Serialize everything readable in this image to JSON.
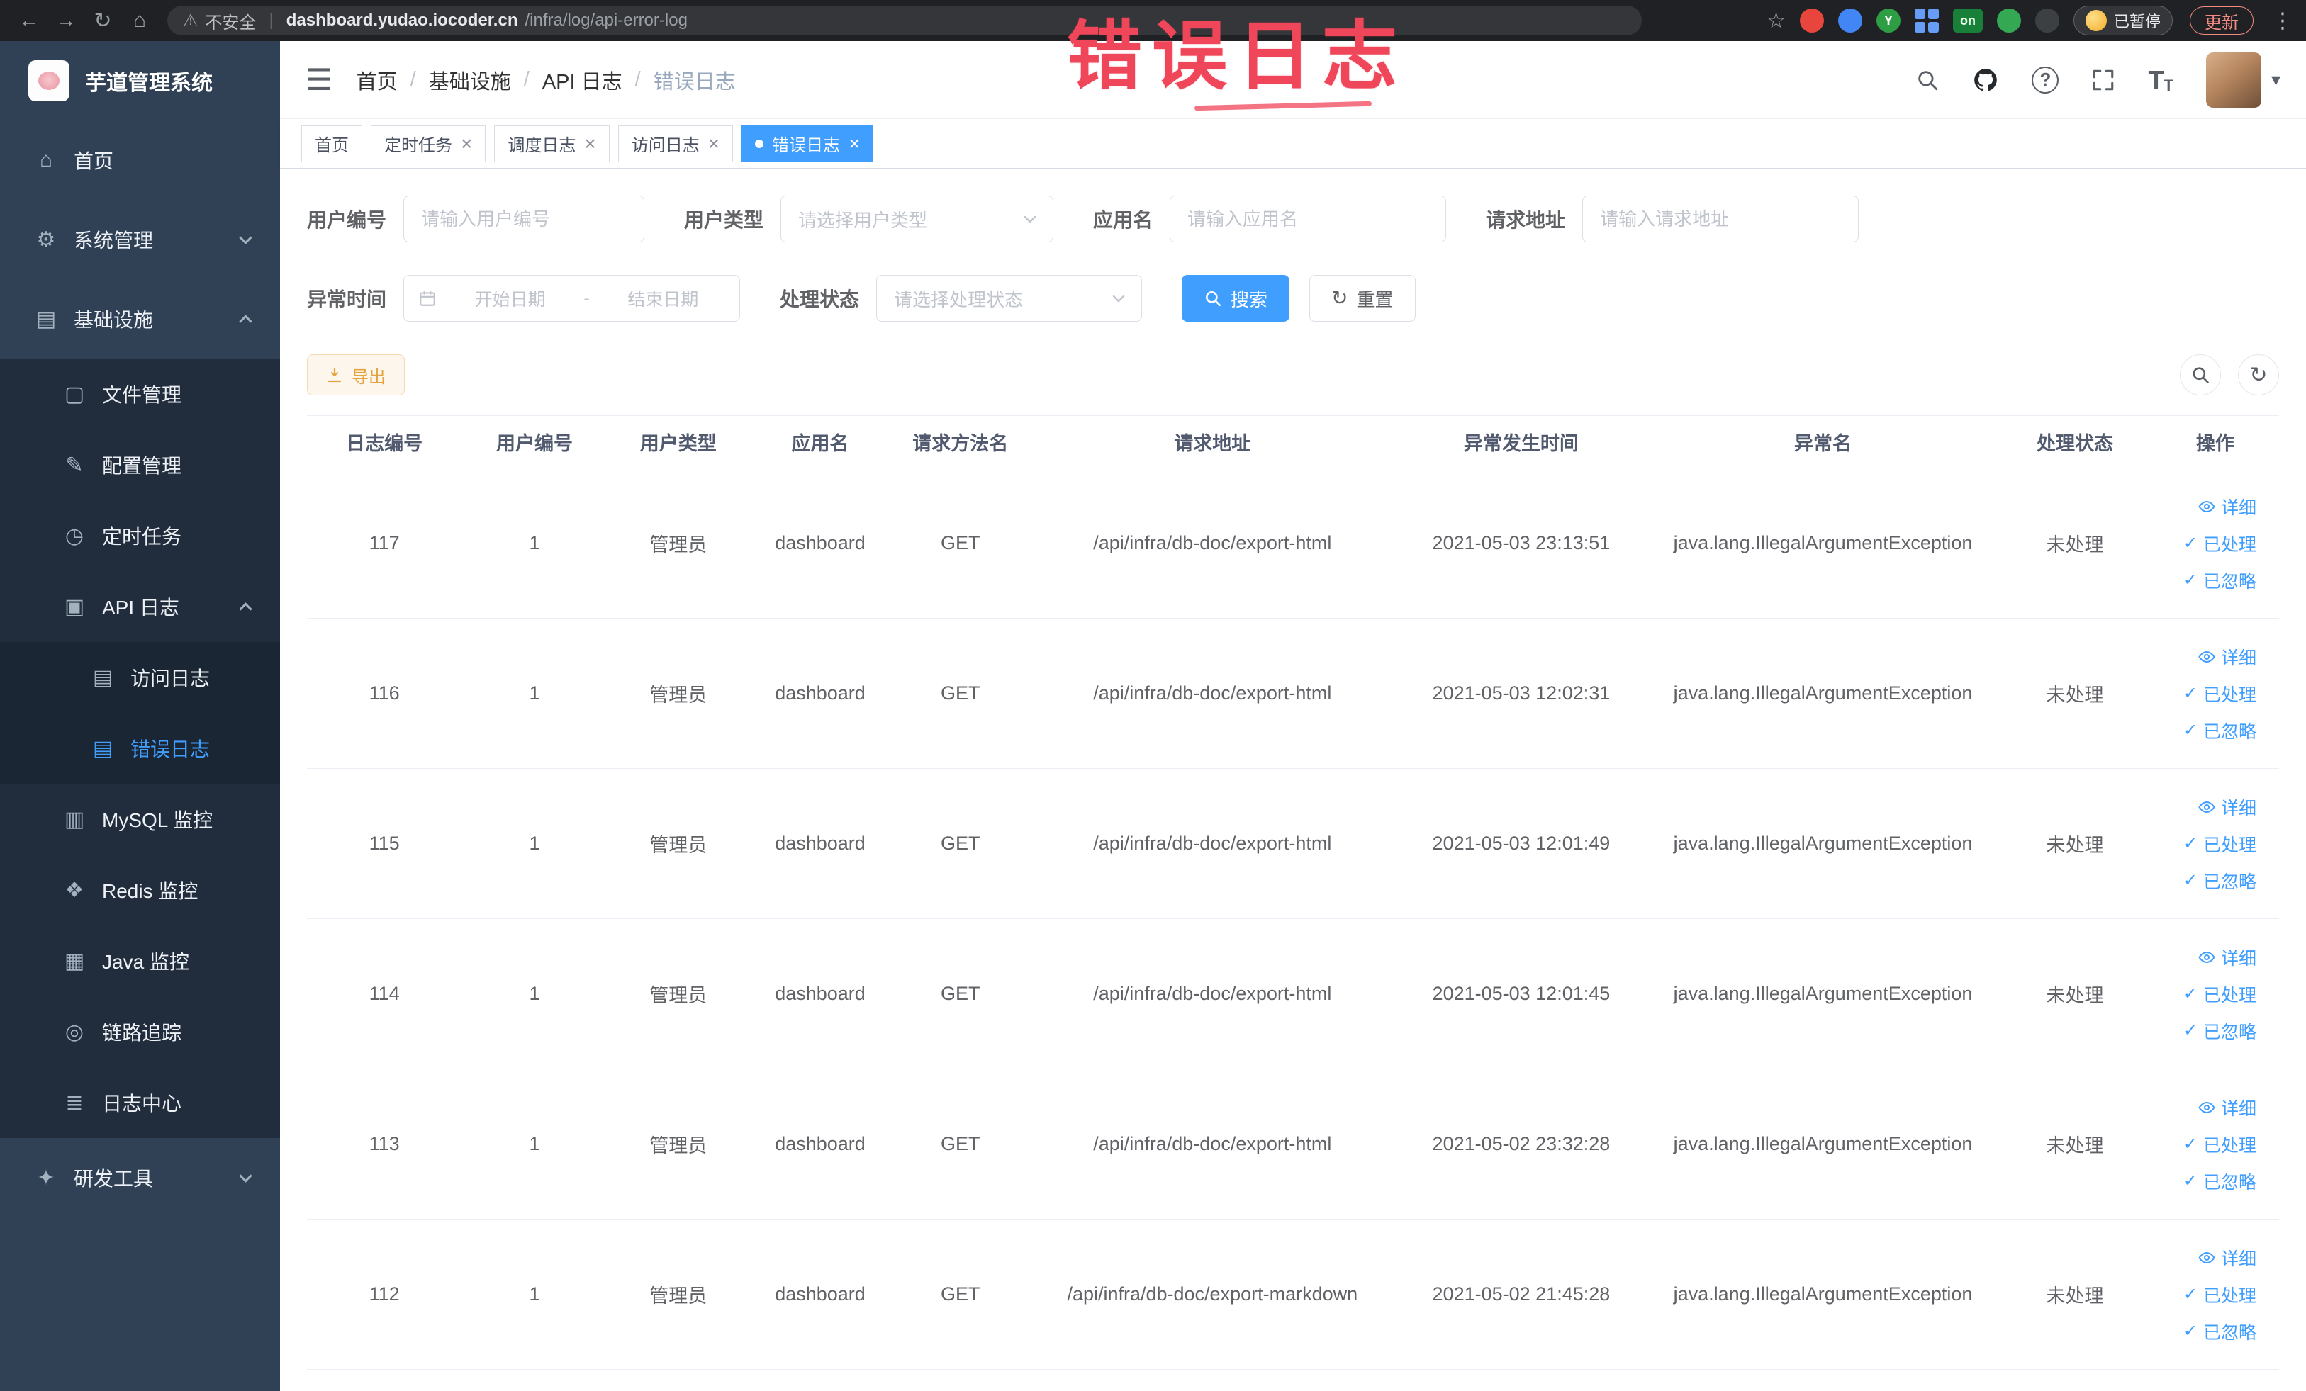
{
  "browser": {
    "security_label": "不安全",
    "url_domain": "dashboard.yudao.iocoder.cn",
    "url_path": "/infra/log/api-error-log",
    "paused_badge": "已暂停",
    "update_button": "更新",
    "extension_on_badge": "on",
    "extension_y_label": "Y"
  },
  "glyphs": {
    "back": "←",
    "forward": "→",
    "reload": "↻",
    "home": "⌂",
    "warning": "⚠",
    "star": "☆",
    "kebab": "⋮",
    "hamburger": "☰",
    "caret_down": "▾",
    "close": "×",
    "check": "✓",
    "refresh": "↻",
    "question": "?",
    "font_size_big": "T",
    "font_size_small": "T",
    "url_separator": "|",
    "breadcrumb_separator": "/"
  },
  "annotation": {
    "text": "错误日志"
  },
  "sidebar": {
    "logo_title": "芋道管理系统",
    "menu": {
      "home": "首页",
      "system": "系统管理",
      "infra": "基础设施",
      "file": "文件管理",
      "config": "配置管理",
      "job": "定时任务",
      "apilog": "API 日志",
      "access": "访问日志",
      "error": "错误日志",
      "mysql": "MySQL 监控",
      "redis": "Redis 监控",
      "java": "Java 监控",
      "trace": "链路追踪",
      "logcenter": "日志中心",
      "devtool": "研发工具"
    },
    "menu_glyphs": {
      "home": "⌂",
      "system": "⚙",
      "infra": "▤",
      "file": "▢",
      "config": "✎",
      "job": "◷",
      "apilog": "▣",
      "access": "▤",
      "error": "▤",
      "mysql": "▥",
      "redis": "❖",
      "java": "▦",
      "trace": "◎",
      "logcenter": "≣",
      "devtool": "✦"
    }
  },
  "breadcrumb": {
    "items": [
      "首页",
      "基础设施",
      "API 日志",
      "错误日志"
    ]
  },
  "tabs": {
    "items": [
      {
        "label": "首页"
      },
      {
        "label": "定时任务"
      },
      {
        "label": "调度日志"
      },
      {
        "label": "访问日志"
      },
      {
        "label": "错误日志"
      }
    ]
  },
  "filters": {
    "user_id": {
      "label": "用户编号",
      "placeholder": "请输入用户编号",
      "value": ""
    },
    "user_type": {
      "label": "用户类型",
      "placeholder": "请选择用户类型"
    },
    "app_name": {
      "label": "应用名",
      "placeholder": "请输入应用名",
      "value": ""
    },
    "request_url": {
      "label": "请求地址",
      "placeholder": "请输入请求地址",
      "value": ""
    },
    "exception_time": {
      "label": "异常时间",
      "start_placeholder": "开始日期",
      "end_placeholder": "结束日期",
      "separator": "-"
    },
    "process_status": {
      "label": "处理状态",
      "placeholder": "请选择处理状态"
    },
    "search_button": "搜索",
    "reset_button": "重置"
  },
  "toolbar": {
    "export_button": "导出"
  },
  "table": {
    "columns": [
      "日志编号",
      "用户编号",
      "用户类型",
      "应用名",
      "请求方法名",
      "请求地址",
      "异常发生时间",
      "异常名",
      "处理状态",
      "操作"
    ],
    "action_labels": {
      "detail": "详细",
      "processed": "已处理",
      "ignored": "已忽略"
    },
    "rows": [
      {
        "log_id": "117",
        "user_id": "1",
        "user_type": "管理员",
        "app_name": "dashboard",
        "method": "GET",
        "request_url": "/api/infra/db-doc/export-html",
        "exception_time": "2021-05-03 23:13:51",
        "exception_name": "java.lang.IllegalArgumentException",
        "status": "未处理"
      },
      {
        "log_id": "116",
        "user_id": "1",
        "user_type": "管理员",
        "app_name": "dashboard",
        "method": "GET",
        "request_url": "/api/infra/db-doc/export-html",
        "exception_time": "2021-05-03 12:02:31",
        "exception_name": "java.lang.IllegalArgumentException",
        "status": "未处理"
      },
      {
        "log_id": "115",
        "user_id": "1",
        "user_type": "管理员",
        "app_name": "dashboard",
        "method": "GET",
        "request_url": "/api/infra/db-doc/export-html",
        "exception_time": "2021-05-03 12:01:49",
        "exception_name": "java.lang.IllegalArgumentException",
        "status": "未处理"
      },
      {
        "log_id": "114",
        "user_id": "1",
        "user_type": "管理员",
        "app_name": "dashboard",
        "method": "GET",
        "request_url": "/api/infra/db-doc/export-html",
        "exception_time": "2021-05-03 12:01:45",
        "exception_name": "java.lang.IllegalArgumentException",
        "status": "未处理"
      },
      {
        "log_id": "113",
        "user_id": "1",
        "user_type": "管理员",
        "app_name": "dashboard",
        "method": "GET",
        "request_url": "/api/infra/db-doc/export-html",
        "exception_time": "2021-05-02 23:32:28",
        "exception_name": "java.lang.IllegalArgumentException",
        "status": "未处理"
      },
      {
        "log_id": "112",
        "user_id": "1",
        "user_type": "管理员",
        "app_name": "dashboard",
        "method": "GET",
        "request_url": "/api/infra/db-doc/export-markdown",
        "exception_time": "2021-05-02 21:45:28",
        "exception_name": "java.lang.IllegalArgumentException",
        "status": "未处理"
      }
    ]
  },
  "colors": {
    "accent": "#409EFF",
    "annotation": "#f0465a",
    "warning": "#E6A23C",
    "sidebar_bg": "#304156",
    "sidebar_sub_bg": "#212d3d"
  }
}
